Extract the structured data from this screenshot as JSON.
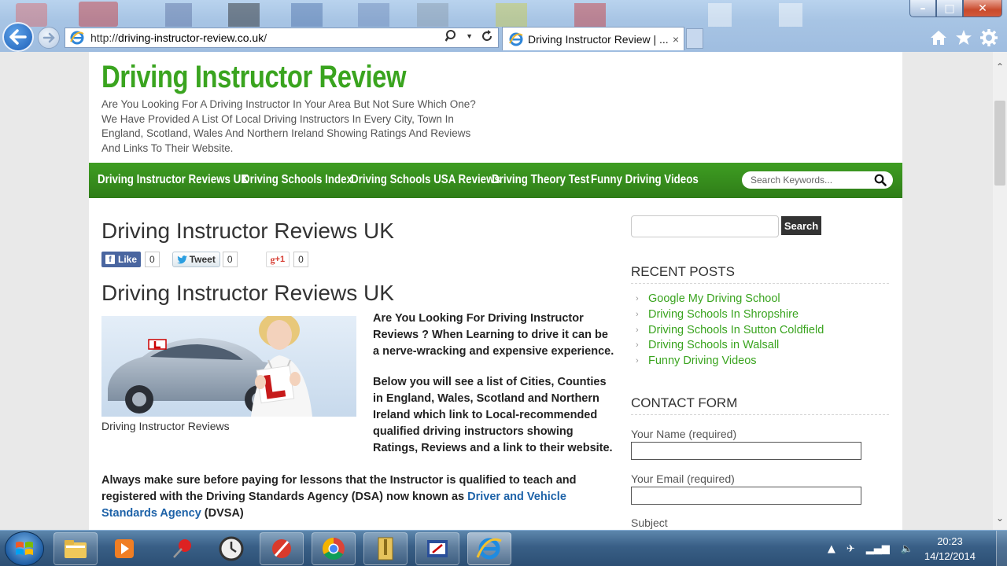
{
  "browser": {
    "url_prefix": "http://",
    "url_domain": "driving-instructor-review.co.uk",
    "url_suffix": "/",
    "tab_title": "Driving Instructor Review | ...",
    "tab_close": "×"
  },
  "site": {
    "title": "Driving Instructor Review",
    "tagline": "Are You Looking For A Driving Instructor In Your Area But Not Sure Which One? We Have Provided A List Of Local Driving Instructors In Every City, Town In England, Scotland, Wales And Northern Ireland Showing Ratings And Reviews And Links To Their Website."
  },
  "nav": {
    "items": [
      "Driving Instructor Reviews UK",
      "Driving Schools Index",
      "Driving Schools USA Reviews",
      "Driving Theory Test",
      "Funny Driving Videos"
    ],
    "search_placeholder": "Search Keywords..."
  },
  "post": {
    "title": "Driving Instructor Reviews UK",
    "heading": "Driving Instructor Reviews UK",
    "share": {
      "like_label": "Like",
      "like_count": "0",
      "tweet_label": "Tweet",
      "tweet_count": "0",
      "gplus_label": "+1",
      "gplus_count": "0"
    },
    "image_caption": "Driving Instructor Reviews",
    "intro_1": "Are You Looking For Driving Instructor Reviews ? When Learning to drive it can be a nerve-wracking and expensive experience.",
    "intro_2": "Below you will see a list of Cities, Counties in England, Wales, Scotland and Northern Ireland which link to Local-recommended qualified driving instructors showing Ratings, Reviews and a link to their website.",
    "para_text": "Always make sure before paying for lessons that the Instructor is qualified to teach and registered with the Driving Standards Agency (DSA) now known as ",
    "para_link": "Driver and Vehicle Standards Agency",
    "para_end": " (DVSA)"
  },
  "sidebar": {
    "search_button": "Search",
    "recent_title": "RECENT POSTS",
    "recent_posts": [
      "Google My Driving School",
      "Driving Schools In Shropshire",
      "Driving Schools In Sutton Coldfield",
      "Driving Schools in Walsall",
      "Funny Driving Videos"
    ],
    "contact_title": "CONTACT FORM",
    "name_label": "Your Name (required)",
    "email_label": "Your Email (required)",
    "subject_label": "Subject"
  },
  "taskbar": {
    "time": "20:23",
    "date": "14/12/2014"
  },
  "colors": {
    "brand_green": "#3aa41f",
    "nav_green": "#2f7d18",
    "link_blue": "#1d62a8"
  }
}
